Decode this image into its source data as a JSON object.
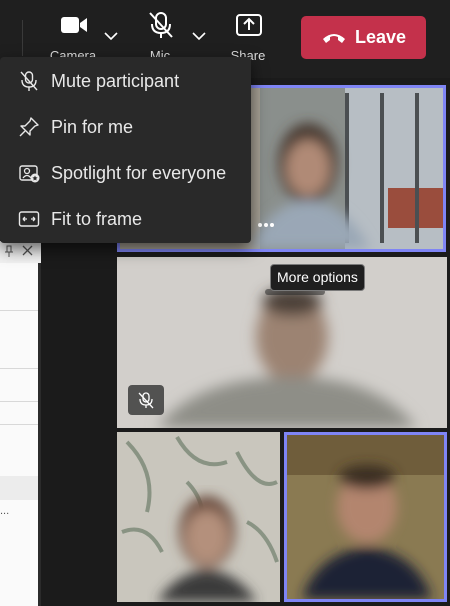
{
  "toolbar": {
    "camera_label": "Camera",
    "mic_label": "Mic",
    "share_label": "Share",
    "leave_label": "Leave"
  },
  "menu": {
    "items": [
      {
        "label": "Mute participant",
        "icon": "mic-off-icon"
      },
      {
        "label": "Pin for me",
        "icon": "pin-icon"
      },
      {
        "label": "Spotlight for everyone",
        "icon": "spotlight-icon"
      },
      {
        "label": "Fit to frame",
        "icon": "fit-to-frame-icon"
      }
    ]
  },
  "tooltip": {
    "text": "More options"
  },
  "sidepanel": {
    "ellipsis": "..."
  },
  "colors": {
    "accent": "#7f85f5",
    "leave": "#c4314b",
    "background": "#1b1b1b",
    "menu": "#292929"
  }
}
